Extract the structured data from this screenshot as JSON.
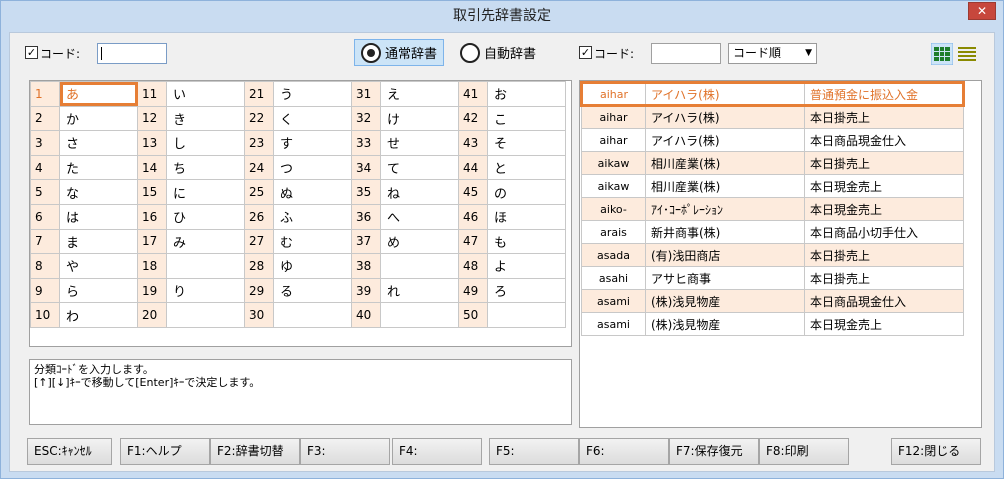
{
  "window": {
    "title": "取引先辞書設定",
    "close_label": "✕"
  },
  "left_filter": {
    "checkbox_label": "コード:",
    "checked": true,
    "code_value": ""
  },
  "radio": {
    "normal_label": "通常辞書",
    "auto_label": "自動辞書",
    "selected": "normal"
  },
  "right_filter": {
    "checkbox_label": "コード:",
    "checked": true,
    "code_value": "",
    "sort_selected": "コード順"
  },
  "view_icons": [
    "grid-view-icon",
    "list-view-icon"
  ],
  "kana_grid": [
    [
      {
        "n": "1",
        "k": "あ"
      },
      {
        "n": "11",
        "k": "い"
      },
      {
        "n": "21",
        "k": "う"
      },
      {
        "n": "31",
        "k": "え"
      },
      {
        "n": "41",
        "k": "お"
      }
    ],
    [
      {
        "n": "2",
        "k": "か"
      },
      {
        "n": "12",
        "k": "き"
      },
      {
        "n": "22",
        "k": "く"
      },
      {
        "n": "32",
        "k": "け"
      },
      {
        "n": "42",
        "k": "こ"
      }
    ],
    [
      {
        "n": "3",
        "k": "さ"
      },
      {
        "n": "13",
        "k": "し"
      },
      {
        "n": "23",
        "k": "す"
      },
      {
        "n": "33",
        "k": "せ"
      },
      {
        "n": "43",
        "k": "そ"
      }
    ],
    [
      {
        "n": "4",
        "k": "た"
      },
      {
        "n": "14",
        "k": "ち"
      },
      {
        "n": "24",
        "k": "つ"
      },
      {
        "n": "34",
        "k": "て"
      },
      {
        "n": "44",
        "k": "と"
      }
    ],
    [
      {
        "n": "5",
        "k": "な"
      },
      {
        "n": "15",
        "k": "に"
      },
      {
        "n": "25",
        "k": "ぬ"
      },
      {
        "n": "35",
        "k": "ね"
      },
      {
        "n": "45",
        "k": "の"
      }
    ],
    [
      {
        "n": "6",
        "k": "は"
      },
      {
        "n": "16",
        "k": "ひ"
      },
      {
        "n": "26",
        "k": "ふ"
      },
      {
        "n": "36",
        "k": "へ"
      },
      {
        "n": "46",
        "k": "ほ"
      }
    ],
    [
      {
        "n": "7",
        "k": "ま"
      },
      {
        "n": "17",
        "k": "み"
      },
      {
        "n": "27",
        "k": "む"
      },
      {
        "n": "37",
        "k": "め"
      },
      {
        "n": "47",
        "k": "も"
      }
    ],
    [
      {
        "n": "8",
        "k": "や"
      },
      {
        "n": "18",
        "k": ""
      },
      {
        "n": "28",
        "k": "ゆ"
      },
      {
        "n": "38",
        "k": ""
      },
      {
        "n": "48",
        "k": "よ"
      }
    ],
    [
      {
        "n": "9",
        "k": "ら"
      },
      {
        "n": "19",
        "k": "り"
      },
      {
        "n": "29",
        "k": "る"
      },
      {
        "n": "39",
        "k": "れ"
      },
      {
        "n": "49",
        "k": "ろ"
      }
    ],
    [
      {
        "n": "10",
        "k": "わ"
      },
      {
        "n": "20",
        "k": ""
      },
      {
        "n": "30",
        "k": ""
      },
      {
        "n": "40",
        "k": ""
      },
      {
        "n": "50",
        "k": ""
      }
    ]
  ],
  "dictionary": [
    {
      "code": "aihar",
      "name": "アイハラ(株)",
      "desc": "普通預金に振込入金",
      "selected": true
    },
    {
      "code": "aihar",
      "name": "アイハラ(株)",
      "desc": "本日掛売上"
    },
    {
      "code": "aihar",
      "name": "アイハラ(株)",
      "desc": "本日商品現金仕入"
    },
    {
      "code": "aikaw",
      "name": "相川産業(株)",
      "desc": "本日掛売上"
    },
    {
      "code": "aikaw",
      "name": "相川産業(株)",
      "desc": "本日現金売上"
    },
    {
      "code": "aiko-",
      "name": "ｱｲ･ｺｰﾎﾟﾚｰｼｮﾝ",
      "desc": "本日現金売上"
    },
    {
      "code": "arais",
      "name": "新井商事(株)",
      "desc": "本日商品小切手仕入"
    },
    {
      "code": "asada",
      "name": "(有)浅田商店",
      "desc": "本日掛売上"
    },
    {
      "code": "asahi",
      "name": "アサヒ商事",
      "desc": "本日掛売上"
    },
    {
      "code": "asami",
      "name": "(株)浅見物産",
      "desc": "本日商品現金仕入"
    },
    {
      "code": "asami",
      "name": "(株)浅見物産",
      "desc": "本日現金売上"
    }
  ],
  "message": {
    "line1": "分類ｺｰﾄﾞを入力します。",
    "line2": "[↑][↓]ｷｰで移動して[Enter]ｷｰで決定します。"
  },
  "function_keys": [
    {
      "key": "esc",
      "label": "ESC:ｷｬﾝｾﾙ"
    },
    {
      "key": "f1",
      "label": "F1:ヘルプ"
    },
    {
      "key": "f2",
      "label": "F2:辞書切替"
    },
    {
      "key": "f3",
      "label": "F3:"
    },
    {
      "key": "f4",
      "label": "F4:"
    },
    {
      "key": "f5",
      "label": "F5:"
    },
    {
      "key": "f6",
      "label": "F6:"
    },
    {
      "key": "f7",
      "label": "F7:保存復元"
    },
    {
      "key": "f8",
      "label": "F8:印刷"
    },
    {
      "key": "f12",
      "label": "F12:閉じる"
    }
  ],
  "colors": {
    "highlight": "#e67e35",
    "row_tint": "#fdebdd",
    "selected_radio_bg": "#cce4f7"
  }
}
